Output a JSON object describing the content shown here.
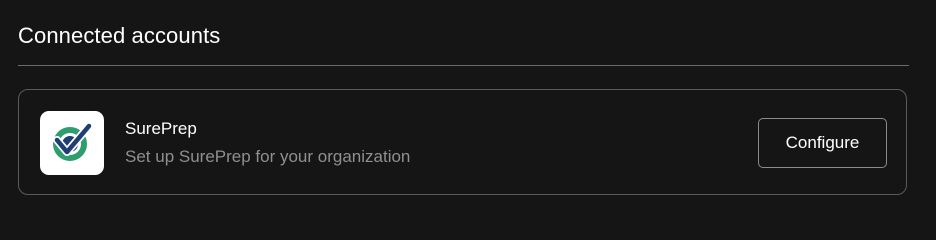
{
  "section": {
    "title": "Connected accounts"
  },
  "accounts": [
    {
      "name": "SurePrep",
      "description": "Set up SurePrep for your organization",
      "icon": "sureprep-logo-icon",
      "action_label": "Configure"
    }
  ],
  "colors": {
    "background": "#151515",
    "card_border": "#5a5a5a",
    "secondary_text": "#8f8f8f",
    "logo_green": "#2f9e6e",
    "logo_navy": "#1f3f73"
  }
}
